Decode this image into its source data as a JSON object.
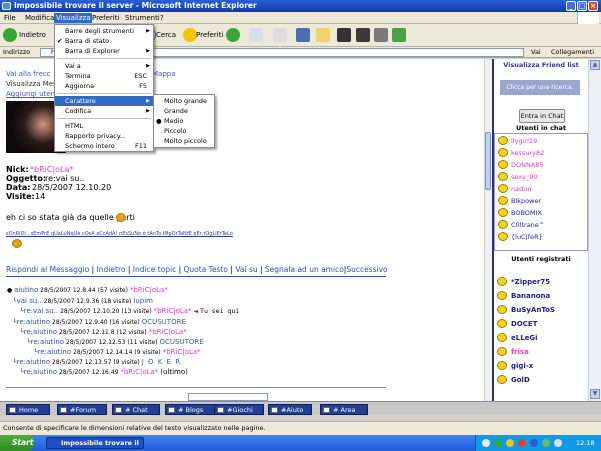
{
  "window": {
    "title": "Impossibile trovare il server - Microsoft Internet Explorer"
  },
  "menubar": [
    "File",
    "Modifica",
    "Visualizza",
    "Preferiti",
    "Strumenti",
    "?"
  ],
  "toolbar": {
    "back": "Indietro",
    "search": "Cerca",
    "favorites": "Preferiti"
  },
  "addressbar": {
    "label": "Indirizzo",
    "value": "http",
    "go": "Vai",
    "links": "Collegamenti"
  },
  "view_menu": {
    "items": [
      {
        "label": "Barre degli strumenti",
        "arrow": true
      },
      {
        "label": "Barra di stato",
        "check": true
      },
      {
        "label": "Barra di Explorer",
        "arrow": true
      },
      {
        "label": "Vai a",
        "arrow": true
      },
      {
        "label": "Termina",
        "shortcut": "ESC"
      },
      {
        "label": "Aggiorna",
        "shortcut": "F5"
      },
      {
        "label": "Carattere",
        "arrow": true,
        "selected": true
      },
      {
        "label": "Codifica",
        "arrow": true
      },
      {
        "label": "HTML"
      },
      {
        "label": "Rapporto privacy..."
      },
      {
        "label": "Schermo intero",
        "shortcut": "F11"
      }
    ],
    "char_submenu": [
      "Molto grande",
      "Grande",
      "Medio",
      "Piccolo",
      "Molto piccolo"
    ],
    "char_selected": "Medio"
  },
  "page": {
    "breadcrumb_start": "Vai alla frecc",
    "breadcrumb_end": "Mappa",
    "visualizza_line": "Visualizza Mes",
    "aggiungi_line": "Aggiungi uten",
    "nick_label": "Nick:",
    "nick_value": "*bRiC|oLa*",
    "oggetto_label": "Oggetto:",
    "oggetto_value": "re:vai su..",
    "data_label": "Data:",
    "data_value": "28/5/2007 12.10.20",
    "visite_label": "Visite:",
    "visite_value": "14",
    "message": "eh ci so stata già da quelle parti",
    "signature": "sOnRiDi...sEmPrE qUaLuNqUe cOsA aCcAdA! nEsSuNo è tAnTo iMpOrTaNtE pEr tOgLiErTeLo",
    "actions": [
      "Rispondi al Messaggio",
      "Indietro",
      "Indice topic",
      "Quota Testo",
      "Vai su",
      "Segnala ad un amico",
      "Successivo"
    ],
    "tree": [
      {
        "title": "aiutino",
        "date": "28/5/2007 12.8.44 (57 visite)",
        "author": "*bRiC|oLa*"
      },
      {
        "title": "vai su..",
        "date": "28/5/2007 12.9.36 (18 visite)",
        "author": "lupim"
      },
      {
        "title": "re:vai su..",
        "date": "28/5/2007 12.10.20 (13 visite)",
        "author": "*bRiC|oLa*",
        "current": "Tu sei qui"
      },
      {
        "title": "re:aiutino",
        "date": "28/5/2007 12.9.40 (16 visite)",
        "author": "OCUSUTORE"
      },
      {
        "title": "re:aiutino",
        "date": "28/5/2007 12.11.8 (12 visite)",
        "author": "*bRiC|oLa*"
      },
      {
        "title": "re:aiutino",
        "date": "28/5/2007 12.12.53 (11 visite)",
        "author": "OCUSUTORE"
      },
      {
        "title": "re:aiutino",
        "date": "28/5/2007 12.14.14 (9 visite)",
        "author": "*bRiC|oLa*"
      },
      {
        "title": "re:aiutino",
        "date": "28/5/2007 12.13.57 (9 visite)",
        "author": "J O K E R"
      },
      {
        "title": "re:aiutino",
        "date": "28/5/2007 12.16.49",
        "author": "*bRiC|oLa*",
        "suffix": "(ultimo)"
      }
    ]
  },
  "sidebar": {
    "friend_list": "Visualizza Friend list",
    "search_placeholder": "Clicca per una ricerca.",
    "enter_chat": "Entra in Chat",
    "users_in_chat_title": "Utenti in chat",
    "chat_users": [
      "llygirl19",
      "kessury82",
      "DONNA85",
      "sexy_90",
      "nadun",
      "Blkpower",
      "BOBOMIX",
      "C0ltrane^",
      "{luC|feR}"
    ],
    "registered_title": "Utenti registrati",
    "registered": [
      "*Zipper75",
      "Bananona",
      "BuSyAnToS",
      "DOCET",
      "eLLeGi",
      "frisa",
      "gigi-x",
      "GolD"
    ]
  },
  "tabs": [
    "Home",
    "#Forum",
    "# Chat",
    "# Blogs",
    "#Giochi",
    "#Aiuto",
    "# Area"
  ],
  "statusbar": "Consente di specificare le dimensioni relative del testo visualizzato nelle pagine.",
  "taskbar": {
    "start": "Start",
    "task": "Impossibile trovare il ...",
    "clock": "12.18"
  }
}
